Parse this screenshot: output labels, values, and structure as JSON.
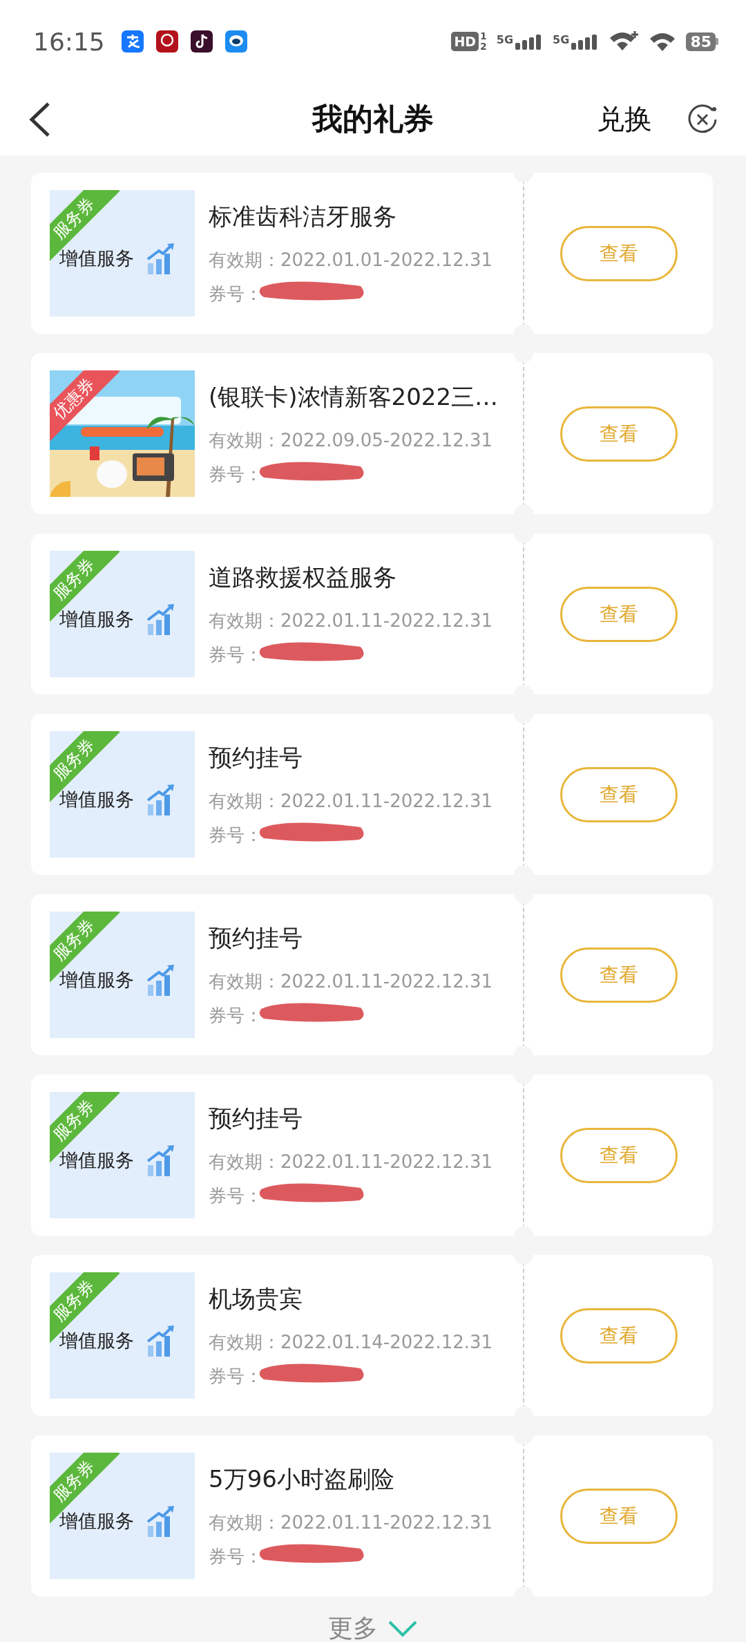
{
  "status_bar": {
    "time": "16:15",
    "hd": "HD",
    "hd_marks": [
      "1",
      "2"
    ],
    "networks": [
      "5G",
      "5G"
    ],
    "battery": "85"
  },
  "header": {
    "title": "我的礼券",
    "action": "兑换"
  },
  "coupons": [
    {
      "title": "标准齿科洁牙服务",
      "ribbon": {
        "label": "服务券",
        "kind": "service"
      },
      "thumb": {
        "kind": "service",
        "label": "增值服务"
      },
      "validity_label": "有效期：",
      "validity": "2022.01.01-2022.12.31",
      "number_label": "券号：",
      "button": "查看"
    },
    {
      "title": "(银联卡)浓情新客2022三…",
      "ribbon": {
        "label": "优惠券",
        "kind": "discount"
      },
      "validity_label": "有效期：",
      "validity": "2022.09.05-2022.12.31",
      "number_label": "券号：",
      "button": "查看"
    },
    {
      "title": "道路救援权益服务",
      "ribbon": {
        "label": "服务券",
        "kind": "service"
      },
      "thumb": {
        "kind": "service",
        "label": "增值服务"
      },
      "validity_label": "有效期：",
      "validity": "2022.01.11-2022.12.31",
      "number_label": "券号：",
      "button": "查看"
    },
    {
      "title": "预约挂号",
      "ribbon": {
        "label": "服务券",
        "kind": "service"
      },
      "thumb": {
        "kind": "service",
        "label": "增值服务"
      },
      "validity_label": "有效期：",
      "validity": "2022.01.11-2022.12.31",
      "number_label": "券号：",
      "button": "查看"
    },
    {
      "title": "预约挂号",
      "ribbon": {
        "label": "服务券",
        "kind": "service"
      },
      "thumb": {
        "kind": "service",
        "label": "增值服务"
      },
      "validity_label": "有效期：",
      "validity": "2022.01.11-2022.12.31",
      "number_label": "券号：",
      "button": "查看"
    },
    {
      "title": "预约挂号",
      "ribbon": {
        "label": "服务券",
        "kind": "service"
      },
      "thumb": {
        "kind": "service",
        "label": "增值服务"
      },
      "validity_label": "有效期：",
      "validity": "2022.01.11-2022.12.31",
      "number_label": "券号：",
      "button": "查看"
    },
    {
      "title": "机场贵宾",
      "ribbon": {
        "label": "服务券",
        "kind": "service"
      },
      "thumb": {
        "kind": "service",
        "label": "增值服务"
      },
      "validity_label": "有效期：",
      "validity": "2022.01.14-2022.12.31",
      "number_label": "券号：",
      "button": "查看"
    },
    {
      "title": "5万96小时盗刷险",
      "ribbon": {
        "label": "服务券",
        "kind": "service"
      },
      "thumb": {
        "kind": "service",
        "label": "增值服务"
      },
      "validity_label": "有效期：",
      "validity": "2022.01.11-2022.12.31",
      "number_label": "券号：",
      "button": "查看"
    }
  ],
  "more": {
    "label": "更多"
  }
}
